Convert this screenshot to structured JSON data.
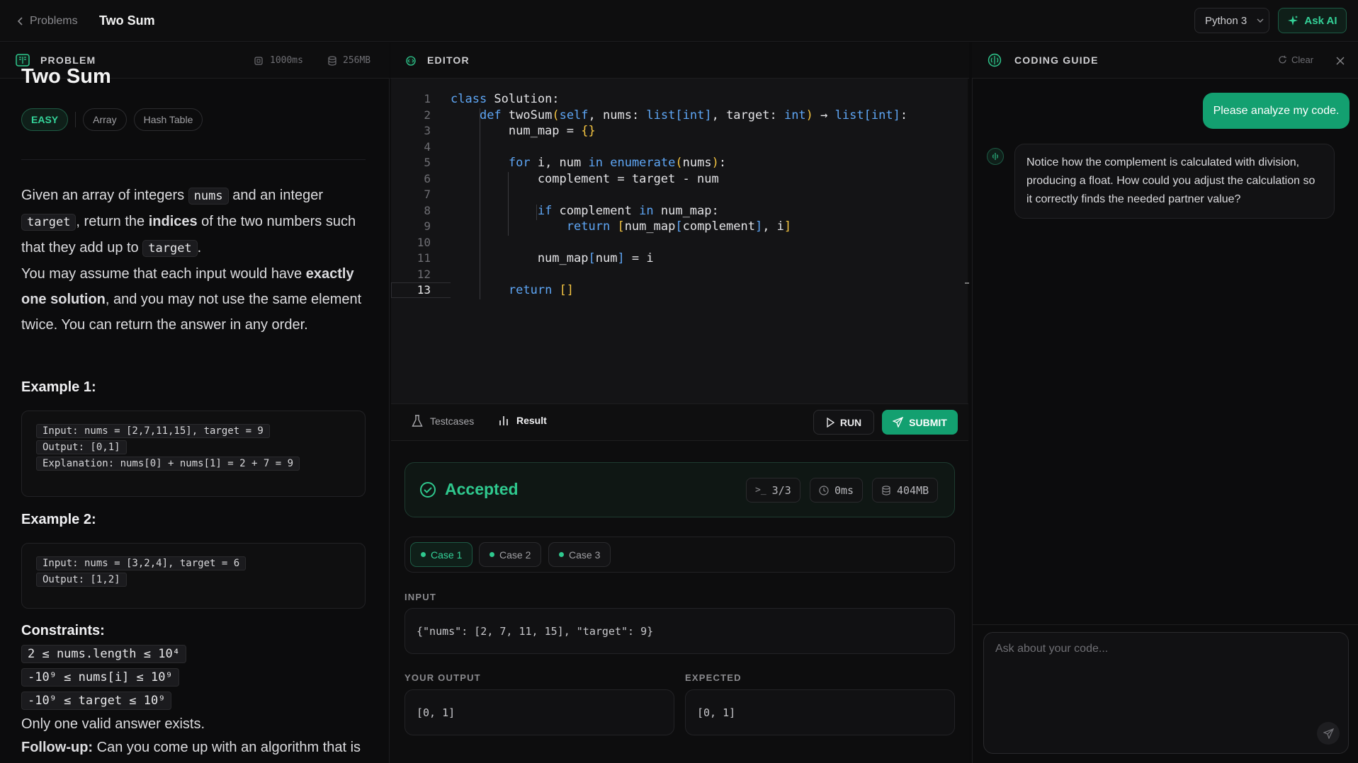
{
  "header": {
    "back_label": "Problems",
    "title": "Two Sum",
    "language": "Python 3",
    "ask_ai_label": "Ask AI"
  },
  "problem_panel": {
    "heading": "PROBLEM",
    "time_limit": "1000ms",
    "memory_limit": "256MB",
    "title": "Two Sum",
    "difficulty": "EASY",
    "tags": [
      "Array",
      "Hash Table"
    ],
    "desc": {
      "p1_a": "Given an array of integers ",
      "p1_code1": "nums",
      "p1_b": " and an integer ",
      "p1_code2": "target",
      "p1_c": ", return the ",
      "p1_bold": "indices",
      "p1_d": " of the two numbers such that they add up to ",
      "p1_code3": "target",
      "p1_e": ".",
      "p2_a": "You may assume that each input would have ",
      "p2_bold": "exactly one solution",
      "p2_b": ", and you may not use the same element twice. You can return the answer in any order."
    },
    "example1": {
      "heading": "Example 1:",
      "input": "Input:  nums = [2,7,11,15], target = 9",
      "output": "Output: [0,1]",
      "explanation": "Explanation: nums[0] + nums[1] = 2 + 7 = 9"
    },
    "example2": {
      "heading": "Example 2:",
      "input": "Input:  nums = [3,2,4], target = 6",
      "output": "Output: [1,2]"
    },
    "constraints_heading": "Constraints:",
    "constraints": [
      "2 ≤ nums.length ≤ 10⁴",
      "-10⁹ ≤ nums[i] ≤ 10⁹",
      "-10⁹ ≤ target ≤ 10⁹"
    ],
    "constraint_note": "Only one valid answer exists.",
    "followup_label": "Follow-up:",
    "followup_text": " Can you come up with an algorithm that is"
  },
  "editor": {
    "heading": "EDITOR",
    "active_line": 13,
    "line_numbers": [
      "1",
      "2",
      "3",
      "4",
      "5",
      "6",
      "7",
      "8",
      "9",
      "10",
      "11",
      "12",
      "13"
    ]
  },
  "tabs": {
    "testcases": "Testcases",
    "result": "Result",
    "run": "RUN",
    "submit": "SUBMIT"
  },
  "result": {
    "status": "Accepted",
    "passed": "3/3",
    "runtime": "0ms",
    "memory": "404MB",
    "cases": [
      "Case 1",
      "Case 2",
      "Case 3"
    ],
    "input_label": "INPUT",
    "input_value": "{\"nums\": [2, 7, 11, 15], \"target\": 9}",
    "output_label": "YOUR OUTPUT",
    "output_value": "[0, 1]",
    "expected_label": "EXPECTED",
    "expected_value": "[0, 1]"
  },
  "guide": {
    "heading": "CODING GUIDE",
    "clear_label": "Clear",
    "user_message": "Please analyze my code.",
    "ai_message": "Notice how the complement is calculated with division, producing a float. How could you adjust the calculation so it correctly finds the needed partner value?",
    "input_placeholder": "Ask about your code..."
  },
  "colors": {
    "accent": "#13a070",
    "accent_text": "#34d399",
    "keyword": "#5ea6f5",
    "bracket": "#f5c542"
  }
}
